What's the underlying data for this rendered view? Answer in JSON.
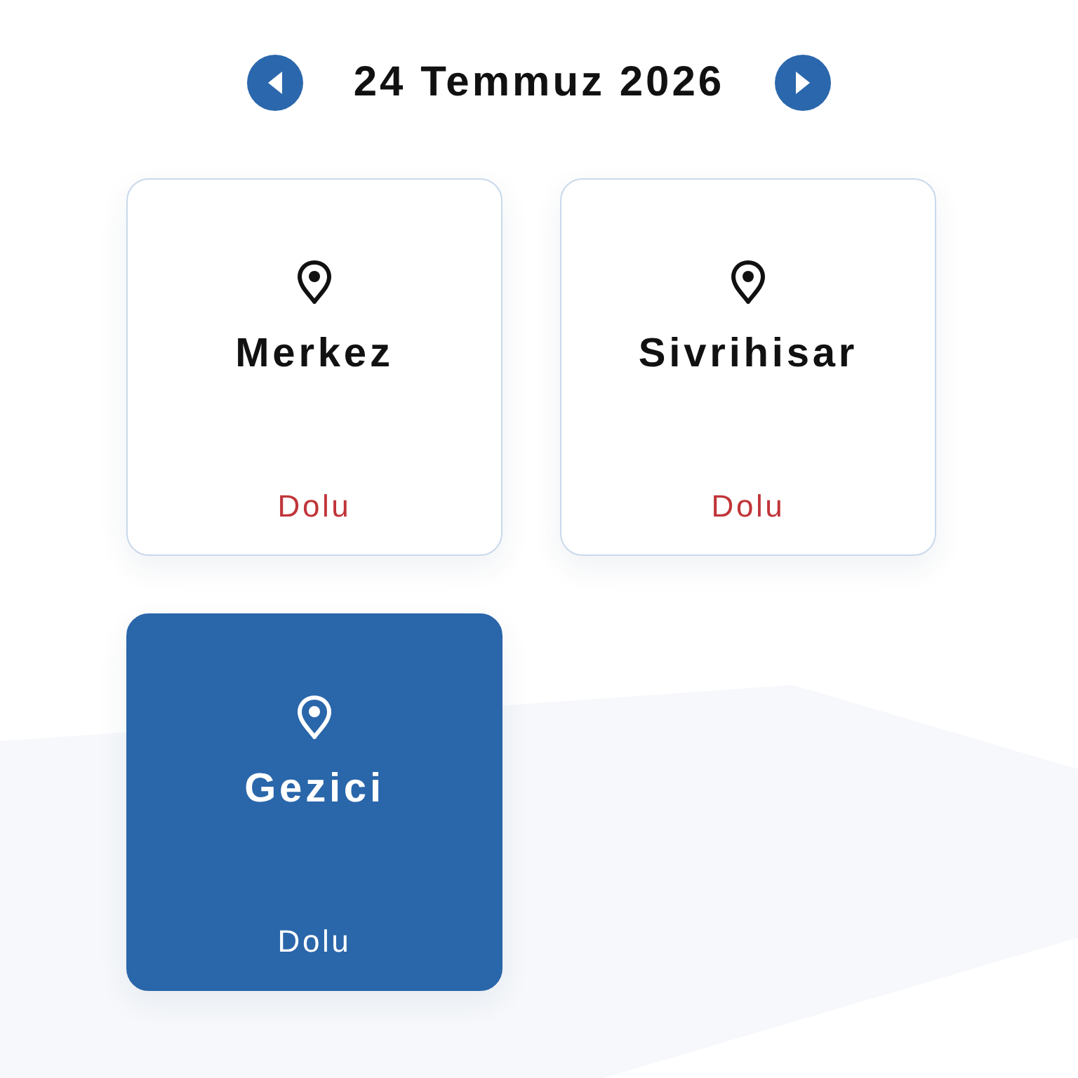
{
  "date_nav": {
    "title": "24 Temmuz 2026"
  },
  "locations": [
    {
      "name": "Merkez",
      "status": "Dolu",
      "selected": false
    },
    {
      "name": "Sivrihisar",
      "status": "Dolu",
      "selected": false
    },
    {
      "name": "Gezici",
      "status": "Dolu",
      "selected": true
    }
  ]
}
